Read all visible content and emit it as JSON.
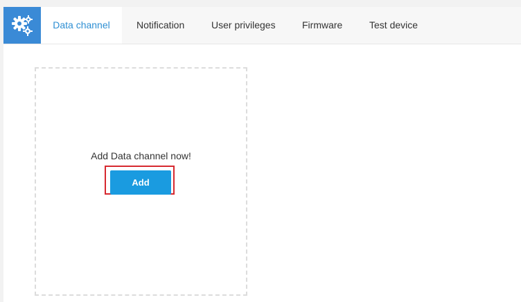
{
  "header": {
    "settings_icon": "gears-icon",
    "accent_color": "#3a8ad6",
    "tabs": [
      {
        "label": "Data channel",
        "active": true
      },
      {
        "label": "Notification",
        "active": false
      },
      {
        "label": "User privileges",
        "active": false
      },
      {
        "label": "Firmware",
        "active": false
      },
      {
        "label": "Test device",
        "active": false
      }
    ]
  },
  "main": {
    "empty_message": "Add Data channel now!",
    "add_button_label": "Add",
    "add_button_color": "#1a9be0",
    "highlight_color": "#d6282f"
  }
}
